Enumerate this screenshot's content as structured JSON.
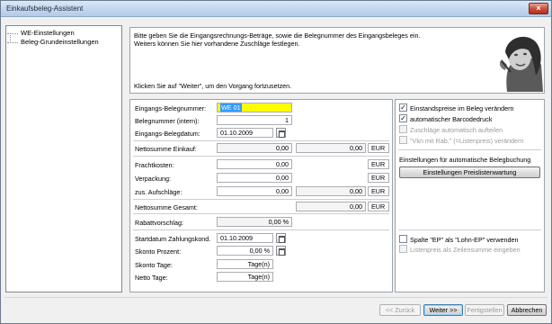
{
  "window": {
    "title": "Einkaufsbeleg-Assistent",
    "close_label": "×"
  },
  "tree": {
    "items": [
      {
        "label": "WE-Einstellungen"
      },
      {
        "label": "Beleg-Grundeinstellungen"
      }
    ]
  },
  "info": {
    "line1": "Bitte geben Sie die Eingangsrechnungs-Beträge, sowie die Belegnummer des Eingangsbeleges ein.",
    "line2": "Weiters können Sie hier vorhandene Zuschläge festlegen.",
    "line3": "Klicken Sie auf \"Weiter\", um den Vorgang fortzusetzen."
  },
  "form": {
    "eingangs_belegnummer": {
      "label": "Eingangs-Belegnummer:",
      "value": "WE 01"
    },
    "belegnummer_intern": {
      "label": "Belegnummer (intern):",
      "value": "1"
    },
    "eingangs_belegdatum": {
      "label": "Eingangs-Belegdatum:",
      "value": "01.10.2009"
    },
    "nettosumme_einkauf": {
      "label": "Nettosumme Einkauf:",
      "value1": "0,00",
      "value2": "0,00",
      "unit": "EUR"
    },
    "frachtkosten": {
      "label": "Frachtkosten:",
      "value": "0,00",
      "unit": "EUR"
    },
    "verpackung": {
      "label": "Verpackung:",
      "value": "0,00",
      "unit": "EUR"
    },
    "zus_aufschlaege": {
      "label": "zus. Aufschläge:",
      "value1": "0,00",
      "value2": "0,00",
      "unit": "EUR"
    },
    "nettosumme_gesamt": {
      "label": "Nettosumme Gesamt:",
      "value": "0,00",
      "unit": "EUR"
    },
    "rabattvorschlag": {
      "label": "Rabattvorschlag:",
      "value": "0,00 %"
    },
    "startdatum_zahlungskond": {
      "label": "Startdatum Zahlungskond.",
      "value": "01.10.2009"
    },
    "skonto_prozent": {
      "label": "Skonto Prozent:",
      "value": "0,00 %"
    },
    "skonto_tage": {
      "label": "Skonto Tage:",
      "value": "Tage(n)"
    },
    "netto_tage": {
      "label": "Netto Tage:",
      "value": "Tage(n)"
    }
  },
  "options": {
    "einstandspreise": {
      "label": "Einstandspreise im Beleg verändern",
      "checked": true
    },
    "barcodedruck": {
      "label": "automatischer Barcodedruck",
      "checked": true
    },
    "zuschlaege": {
      "label": "Zuschläge automatisch aufteilen",
      "checked": false
    },
    "vkn_rab": {
      "label": "\"Vkn mit Rab.\" (=Listenpreis) verändern",
      "checked": false
    },
    "belegbuchung_heading": "Einstellungen für automatische Belegbuchung",
    "preislisten_button": "Einstellungen Preislistenwartung",
    "spalte_ep": {
      "label": "Spalte \"EP\" als \"Lohn-EP\" verwenden",
      "checked": false
    },
    "listenpreis": {
      "label": "Listenpreis als Zeilensumme eingeben",
      "checked": false
    }
  },
  "buttons": {
    "back": "<< Zurück",
    "next": "Weiter >>",
    "finish": "Fertigstellen",
    "cancel": "Abbrechen"
  },
  "colors": {
    "highlight": "#ffff00",
    "selection": "#3399ff"
  }
}
